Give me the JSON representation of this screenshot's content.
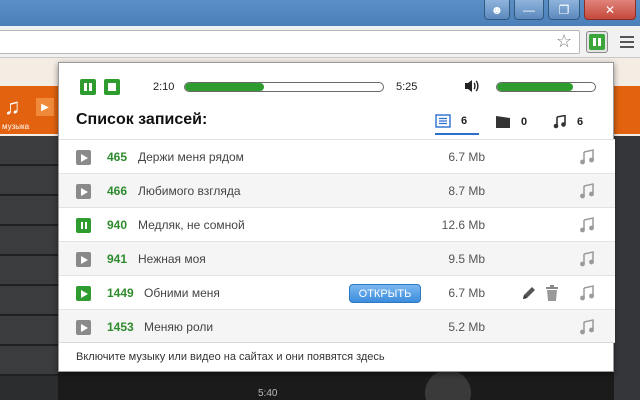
{
  "browser": {
    "window_buttons": [
      "user-icon",
      "minimize-icon",
      "restore-icon",
      "close-icon"
    ],
    "ext_accent": "#3aa53a"
  },
  "player": {
    "elapsed": "2:10",
    "duration": "5:25",
    "progress_fraction": 0.4,
    "volume_fraction": 0.78,
    "accent": "#2e9c2e"
  },
  "list": {
    "title": "Список записей:",
    "tabs": [
      {
        "icon": "list-icon",
        "count": "6",
        "active": true
      },
      {
        "icon": "video-icon",
        "count": "0",
        "active": false
      },
      {
        "icon": "music-icon",
        "count": "6",
        "active": false
      }
    ],
    "rows": [
      {
        "num": "465",
        "name": "Держи меня рядом",
        "size": "6.7 Mb",
        "state": "stopped"
      },
      {
        "num": "466",
        "name": "Любимого взгляда",
        "size": "8.7 Mb",
        "state": "stopped"
      },
      {
        "num": "940",
        "name": "Медляк, не сомной",
        "size": "12.6 Mb",
        "state": "playing"
      },
      {
        "num": "941",
        "name": "Нежная моя",
        "size": "9.5 Mb",
        "state": "stopped"
      },
      {
        "num": "1449",
        "name": "Обними меня",
        "size": "6.7 Mb",
        "state": "hover",
        "open_label": "ОТКРЫТЬ"
      },
      {
        "num": "1453",
        "name": "Меняю роли",
        "size": "5.2 Mb",
        "state": "stopped"
      }
    ],
    "footer": "Включите музыку или видео на сайтах и они появятся здесь"
  },
  "background": {
    "site_label": "музыка",
    "bottom_time": "5:40"
  }
}
